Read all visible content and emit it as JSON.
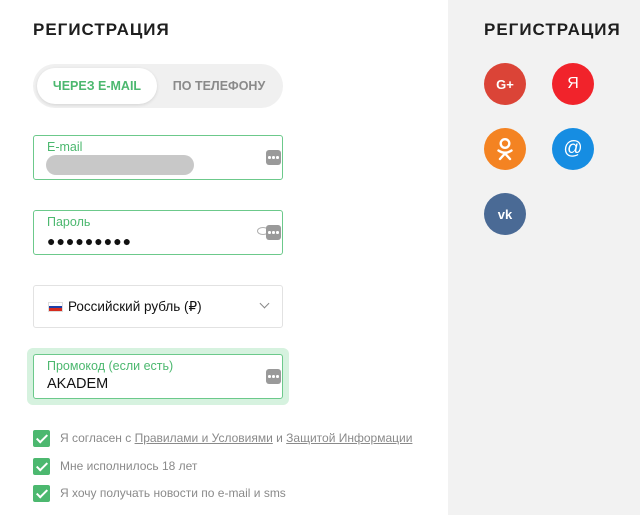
{
  "left": {
    "title": "РЕГИСТРАЦИЯ",
    "tabs": [
      {
        "label": "ЧЕРЕЗ E-MAIL",
        "active": true
      },
      {
        "label": "ПО ТЕЛЕФОНУ",
        "active": false
      }
    ],
    "email": {
      "label": "E-mail"
    },
    "password": {
      "label": "Пароль",
      "value": "●●●●●●●●●"
    },
    "currency": {
      "selected": "Российский рубль (₽)"
    },
    "promo": {
      "label": "Промокод (если есть)",
      "value": "AKADEM"
    },
    "checks": [
      {
        "prefix": "Я согласен с ",
        "link1": "Правилами и Условиями",
        "middle": " и ",
        "link2": "Защитой Информации",
        "checked": true
      },
      {
        "text": "Мне исполнилось 18 лет",
        "checked": true
      },
      {
        "text": "Я хочу получать новости по e-mail и sms",
        "checked": true
      }
    ]
  },
  "right": {
    "title": "РЕГИСТРАЦИЯ",
    "social": [
      {
        "name": "google-plus",
        "glyph": "G+",
        "color": "#db4437"
      },
      {
        "name": "yandex",
        "glyph": "Я",
        "color": "#f1232b"
      },
      {
        "name": "odnoklassniki",
        "glyph": "ok",
        "color": "#f48322"
      },
      {
        "name": "mail-ru",
        "glyph": "@",
        "color": "#168de2"
      },
      {
        "name": "vk",
        "glyph": "vk",
        "color": "#4a6a95"
      }
    ]
  },
  "colors": {
    "accent": "#4cb86f",
    "field_border": "#6cc98b",
    "right_bg": "#f2f2f2"
  }
}
